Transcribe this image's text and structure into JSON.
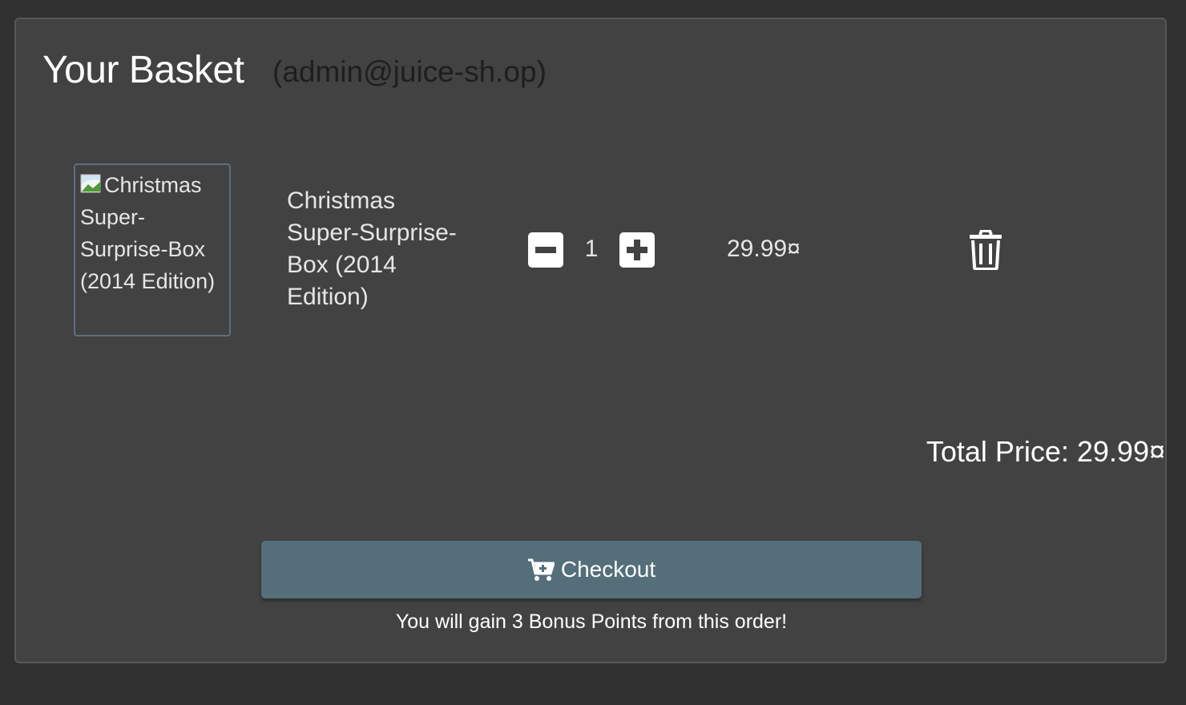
{
  "basket": {
    "title": "Your Basket",
    "user": "(admin@juice-sh.op)"
  },
  "item": {
    "image_alt": "Christmas Super-Surprise-Box (2014 Edition)",
    "name": "Christmas Super-Surprise-Box (2014 Edition)",
    "quantity": "1",
    "price": "29.99¤"
  },
  "summary": {
    "total": "Total Price: 29.99¤"
  },
  "checkout": {
    "label": "Checkout",
    "bonus": "You will gain 3 Bonus Points from this order!"
  },
  "icons": {
    "image": "broken-image-icon",
    "minus": "minus-square-icon",
    "plus": "plus-square-icon",
    "delete": "trash-icon",
    "cart": "cart-plus-icon"
  },
  "colors": {
    "background": "#303030",
    "card": "#424242",
    "checkout_button": "#546e7a",
    "user_email": "#1e1e1e"
  }
}
